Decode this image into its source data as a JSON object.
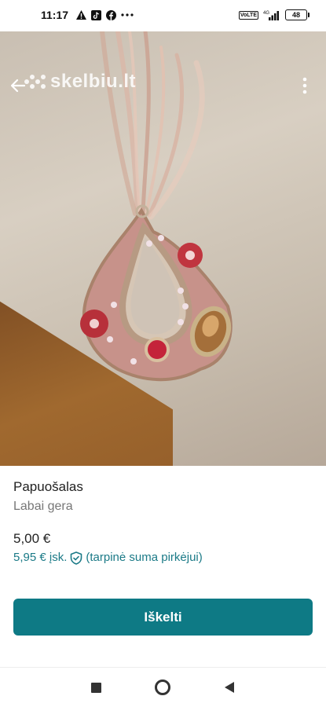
{
  "status_bar": {
    "time": "11:17",
    "icons_left": [
      "warning-icon",
      "tiktok-icon",
      "facebook-icon",
      "more-dots-icon"
    ],
    "volte": "VoLTE",
    "network": "4G",
    "battery": "48"
  },
  "header": {
    "watermark": "skelbiu.lt",
    "back_icon": "arrow-left-icon",
    "menu_icon": "more-vert-icon"
  },
  "listing": {
    "title": "Papuošalas",
    "condition": "Labai gera",
    "price": "5,00 €",
    "buyer_price": "5,95 € įsk.",
    "buyer_note": "(tarpinė suma pirkėjui)",
    "shield_icon": "shield-check-icon"
  },
  "actions": {
    "bump_label": "Iškelti"
  },
  "colors": {
    "accent": "#0e7a85",
    "accent_text": "#1b7a87"
  },
  "nav_bar": {
    "items": [
      "recents-icon",
      "home-icon",
      "back-icon"
    ]
  }
}
